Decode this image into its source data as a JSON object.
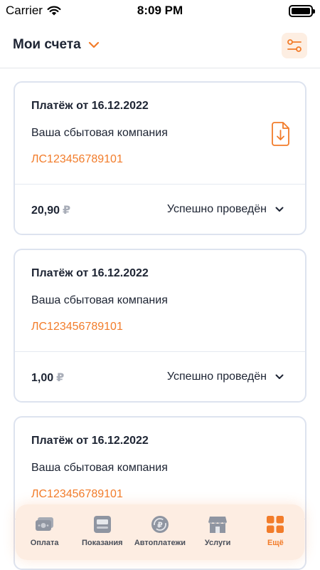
{
  "status_bar": {
    "carrier": "Carrier",
    "time": "8:09 PM"
  },
  "header": {
    "title": "Мои счета",
    "accent_color": "#f27c2a"
  },
  "payments": [
    {
      "title": "Платёж от 16.12.2022",
      "company": "Ваша сбытовая компания",
      "account": "ЛС123456789101",
      "amount": "20,90",
      "currency": "₽",
      "status": "Успешно проведён",
      "has_download": true
    },
    {
      "title": "Платёж от 16.12.2022",
      "company": "Ваша сбытовая компания",
      "account": "ЛС123456789101",
      "amount": "1,00",
      "currency": "₽",
      "status": "Успешно проведён",
      "has_download": false
    },
    {
      "title": "Платёж от 16.12.2022",
      "company": "Ваша сбытовая компания",
      "account": "ЛС123456789101",
      "amount": "",
      "currency": "",
      "status": "",
      "has_download": false
    }
  ],
  "tabbar": {
    "items": [
      {
        "label": "Оплата",
        "icon": "wallet-icon",
        "active": false
      },
      {
        "label": "Показания",
        "icon": "meter-icon",
        "active": false
      },
      {
        "label": "Автоплатежи",
        "icon": "autopay-icon",
        "active": false
      },
      {
        "label": "Услуги",
        "icon": "shop-icon",
        "active": false
      },
      {
        "label": "Ещё",
        "icon": "grid-icon",
        "active": true
      }
    ]
  }
}
